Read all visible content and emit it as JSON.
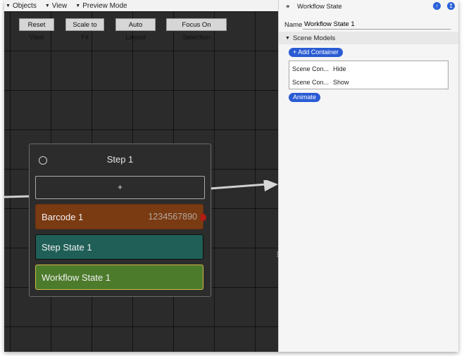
{
  "menubar": {
    "items": [
      {
        "label": "Objects"
      },
      {
        "label": "View"
      },
      {
        "label": "Preview Mode"
      }
    ]
  },
  "toolbar": {
    "reset_view": "Reset View",
    "scale_to_fit": "Scale to Fit",
    "auto_layout": "Auto Layout",
    "focus_on_selection": "Focus On Selection"
  },
  "step_node": {
    "title": "Step 1",
    "add_label": "+",
    "states": [
      {
        "label": "Barcode 1",
        "value": "1234567890",
        "color": "#7a3a12"
      },
      {
        "label": "Step State 1",
        "color": "#1f5f57"
      },
      {
        "label": "Workflow State 1",
        "color": "#4c7b2c"
      }
    ]
  },
  "panel": {
    "header_title": "Workflow State",
    "name_label": "Name",
    "name_value": "Workflow State 1",
    "section_title": "Scene Models",
    "add_container_label": "+ Add Container",
    "rows": [
      {
        "name": "Scene Con...",
        "action": "Hide"
      },
      {
        "name": "Scene Con...",
        "action": "Show"
      }
    ],
    "animate_label": "Animate",
    "accent_color": "#2a5bd4"
  }
}
